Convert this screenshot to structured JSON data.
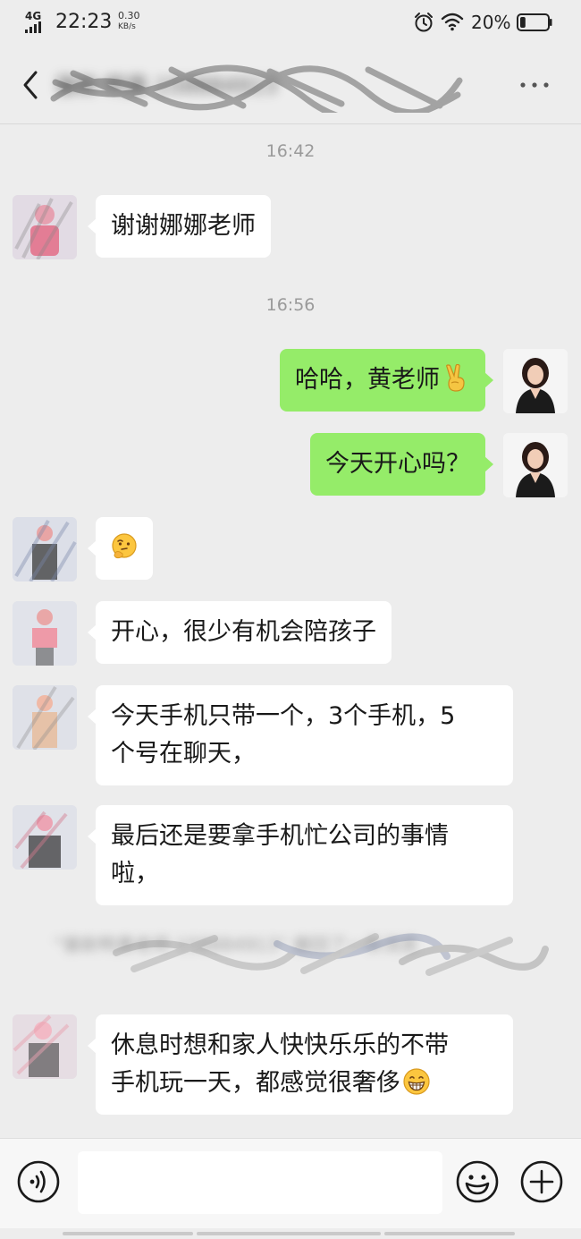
{
  "status_bar": {
    "network": "4G",
    "time": "22:23",
    "speed_value": "0.30",
    "speed_unit": "KB/s",
    "battery_text": "20%",
    "battery_level": 0.2,
    "icons": [
      "signal-icon",
      "alarm-icon",
      "wifi-icon",
      "battery-icon"
    ]
  },
  "header": {
    "back_icon": "chevron-left-icon",
    "title": "骓新     鸭黄   158884913",
    "more_icon": "more-dots-icon"
  },
  "messages": [
    {
      "type": "time",
      "text": "16:42"
    },
    {
      "type": "incoming",
      "text": "谢谢娜娜老师"
    },
    {
      "type": "time",
      "text": "16:56"
    },
    {
      "type": "outgoing",
      "text": "哈哈，黄老师",
      "emoji": "victory-hand-icon"
    },
    {
      "type": "outgoing",
      "text": "今天开心吗？"
    },
    {
      "type": "incoming",
      "text": "",
      "emoji": "thinking-face-icon"
    },
    {
      "type": "incoming",
      "text": "开心，很少有机会陪孩子"
    },
    {
      "type": "incoming",
      "lines": [
        "今天手机只带一个，3个手机，5",
        "个号在聊天，"
      ]
    },
    {
      "type": "incoming",
      "lines": [
        "最后还是要拿手机忙公司的事情",
        "啦，"
      ]
    },
    {
      "type": "system",
      "text": "“骓新鸭黄老师  158884913” 撤回了一条消息"
    },
    {
      "type": "incoming",
      "lines": [
        "休息时想和家人快快乐乐的不带",
        "手机玩一天，都感觉很奢侈"
      ],
      "emoji": "grinning-face-icon"
    }
  ],
  "input_bar": {
    "voice_icon": "voice-icon",
    "emoji_icon": "emoji-icon",
    "plus_icon": "plus-icon",
    "placeholder": ""
  },
  "colors": {
    "background": "#ededed",
    "incoming_bubble": "#ffffff",
    "outgoing_bubble": "#95ec69",
    "timestamp_text": "#9a9a9a"
  }
}
